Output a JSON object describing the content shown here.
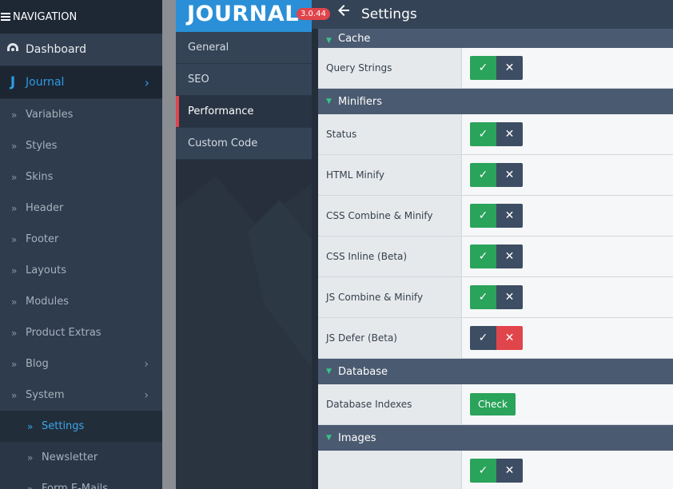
{
  "nav": {
    "header": "NAVIGATION",
    "dashboard": "Dashboard",
    "journal": "Journal",
    "items": [
      "Variables",
      "Styles",
      "Skins",
      "Header",
      "Footer",
      "Layouts",
      "Modules",
      "Product Extras",
      "Blog",
      "System"
    ],
    "sub_items": [
      "Settings",
      "Newsletter",
      "Form E-Mails"
    ]
  },
  "logo": {
    "text": "JOURNAL",
    "version": "3.0.44"
  },
  "topbar": {
    "title": "Settings",
    "back_icon": "arrow-left-icon"
  },
  "menu": {
    "items": [
      "General",
      "SEO",
      "Performance",
      "Custom Code"
    ],
    "active": "Performance"
  },
  "sections": {
    "cache": {
      "title": "Cache",
      "rows": [
        {
          "label": "Query Strings",
          "state": "on"
        }
      ]
    },
    "minifiers": {
      "title": "Minifiers",
      "rows": [
        {
          "label": "Status",
          "state": "on"
        },
        {
          "label": "HTML Minify",
          "state": "on"
        },
        {
          "label": "CSS Combine & Minify",
          "state": "on"
        },
        {
          "label": "CSS Inline (Beta)",
          "state": "on"
        },
        {
          "label": "JS Combine & Minify",
          "state": "on"
        },
        {
          "label": "JS Defer (Beta)",
          "state": "off"
        }
      ]
    },
    "database": {
      "title": "Database",
      "rows": [
        {
          "label": "Database Indexes",
          "button": "Check"
        }
      ]
    },
    "images": {
      "title": "Images"
    }
  },
  "colors": {
    "accent_blue": "#2a8fd6",
    "toggle_on": "#2aa35b",
    "toggle_off_red": "#e0454b",
    "active_marker": "#e0454b"
  }
}
